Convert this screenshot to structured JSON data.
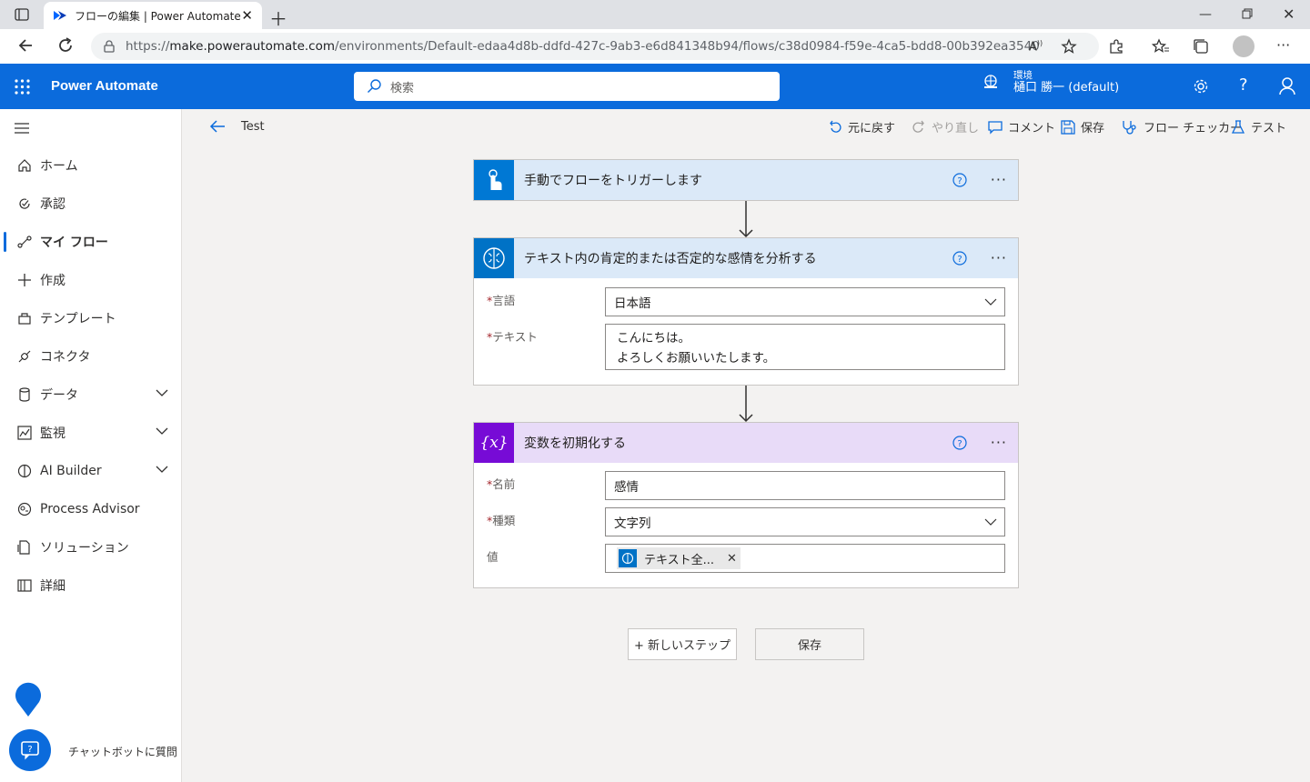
{
  "browser": {
    "tab_title": "フローの編集 | Power Automate",
    "url_prefix": "https://",
    "url_host": "make.powerautomate.com",
    "url_path": "/environments/Default-edaa4d8b-ddfd-427c-9ab3-e6d841348b94/flows/c38d0984-f59e-4ca5-bdd8-00b392ea3540"
  },
  "app": {
    "brand": "Power Automate",
    "search_placeholder": "検索",
    "env_label": "環境",
    "env_name": "樋口 勝一 (default)"
  },
  "sidebar": {
    "items": [
      {
        "label": "ホーム",
        "icon": "home-icon"
      },
      {
        "label": "承認",
        "icon": "approvals-icon"
      },
      {
        "label": "マイ フロー",
        "icon": "flows-icon",
        "selected": true
      },
      {
        "label": "作成",
        "icon": "plus-icon"
      },
      {
        "label": "テンプレート",
        "icon": "templates-icon"
      },
      {
        "label": "コネクタ",
        "icon": "connector-icon"
      },
      {
        "label": "データ",
        "icon": "database-icon",
        "expandable": true
      },
      {
        "label": "監視",
        "icon": "monitor-icon",
        "expandable": true
      },
      {
        "label": "AI Builder",
        "icon": "ai-builder-icon",
        "expandable": true
      },
      {
        "label": "Process Advisor",
        "icon": "process-advisor-icon"
      },
      {
        "label": "ソリューション",
        "icon": "solutions-icon"
      },
      {
        "label": "詳細",
        "icon": "learn-icon"
      }
    ],
    "chatbot_label": "チャットボットに質問"
  },
  "commandbar": {
    "flow_name": "Test",
    "undo": "元に戻す",
    "redo": "やり直し",
    "comment": "コメント",
    "save": "保存",
    "flow_checker": "フロー チェッカー",
    "test": "テスト"
  },
  "steps": {
    "trigger": {
      "title": "手動でフローをトリガーします",
      "color": "#0078d4"
    },
    "sentiment": {
      "title": "テキスト内の肯定的または否定的な感情を分析する",
      "color": "#0072c6",
      "language_label": "言語",
      "language_value": "日本語",
      "text_label": "テキスト",
      "text_line1": "こんにちは。",
      "text_line2": "よろしくお願いいたします。"
    },
    "variable": {
      "title": "変数を初期化する",
      "color": "#770bd6",
      "name_label": "名前",
      "name_value": "感情",
      "type_label": "種類",
      "type_value": "文字列",
      "value_label": "値",
      "value_token": "テキスト全..."
    }
  },
  "footer": {
    "new_step": "+ 新しいステップ",
    "save": "保存"
  },
  "colors": {
    "accent": "#0b6bdc",
    "header_blue_bg": "#dbe9f8",
    "header_purple_bg": "#e8dbf8"
  }
}
